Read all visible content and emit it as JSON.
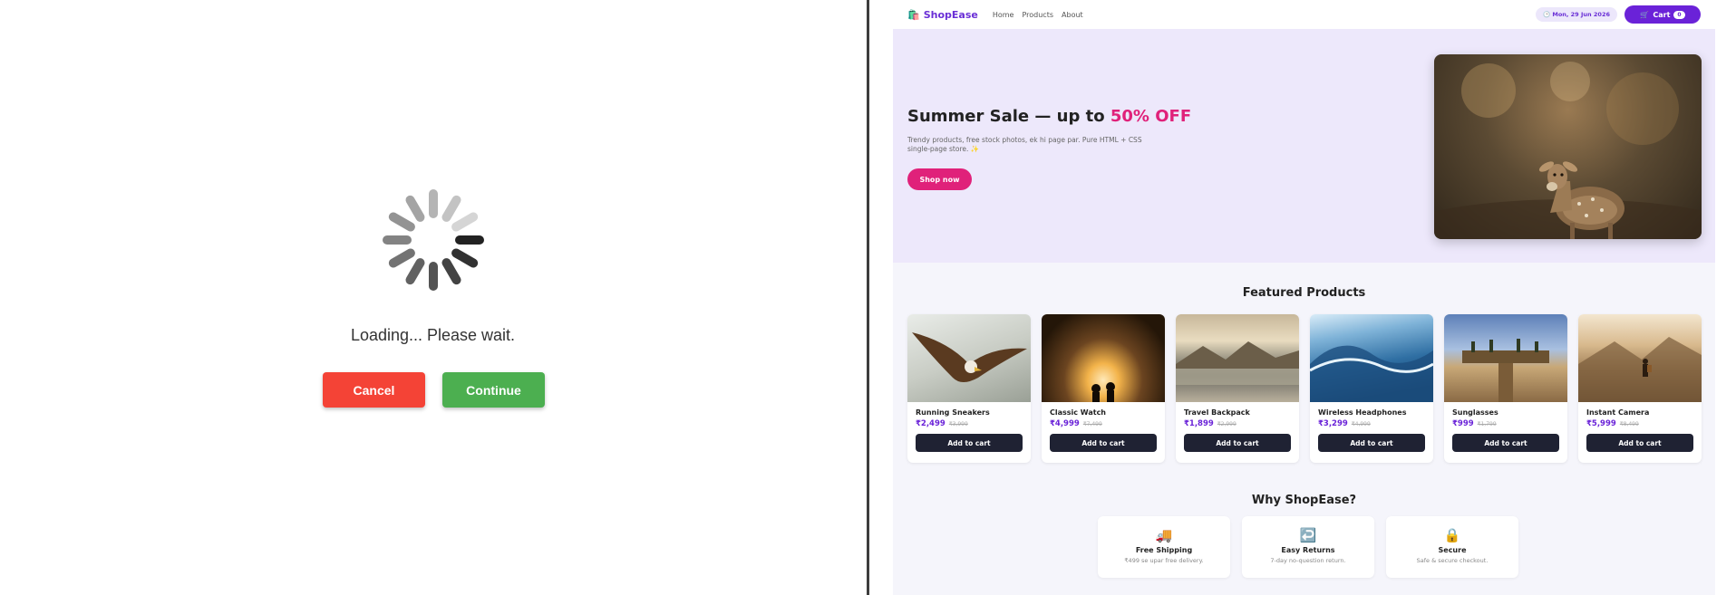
{
  "loading": {
    "message": "Loading... Please wait.",
    "cancel_label": "Cancel",
    "continue_label": "Continue",
    "spinner_icon": "spinner-icon"
  },
  "shop": {
    "brand": "ShopEase",
    "brand_icon": "shopping-bag-icon",
    "nav_links": [
      "Home",
      "Products",
      "About"
    ],
    "date": "Mon, 29 Jun 2026",
    "cart_label": "Cart",
    "cart_count": "0",
    "hero": {
      "title_prefix": "Summer Sale — up to ",
      "title_accent": "50% OFF",
      "subtitle": "Trendy products, free stock photos, ek hi page par. Pure HTML + CSS single-page store. ✨",
      "cta": "Shop now",
      "image_subject": "deer"
    },
    "featured_title": "Featured Products",
    "products": [
      {
        "name": "Running Sneakers",
        "price": "₹2,499",
        "old_price": "₹3,999",
        "cta": "Add to cart",
        "image_subject": "eagle"
      },
      {
        "name": "Classic Watch",
        "price": "₹4,999",
        "old_price": "₹7,499",
        "cta": "Add to cart",
        "image_subject": "cave-silhouettes"
      },
      {
        "name": "Travel Backpack",
        "price": "₹1,899",
        "old_price": "₹2,999",
        "cta": "Add to cart",
        "image_subject": "lake-landscape"
      },
      {
        "name": "Wireless Headphones",
        "price": "₹3,299",
        "old_price": "₹4,999",
        "cta": "Add to cart",
        "image_subject": "ocean-wave"
      },
      {
        "name": "Sunglasses",
        "price": "₹999",
        "old_price": "₹1,799",
        "cta": "Add to cart",
        "image_subject": "pier"
      },
      {
        "name": "Instant Camera",
        "price": "₹5,999",
        "old_price": "₹8,499",
        "cta": "Add to cart",
        "image_subject": "hiker-mountains"
      }
    ],
    "why_title": "Why ShopEase?",
    "features": [
      {
        "icon": "🚚",
        "icon_name": "truck-icon",
        "title": "Free Shipping",
        "desc": "₹499 se upar free delivery."
      },
      {
        "icon": "↩️",
        "icon_name": "return-icon",
        "title": "Easy Returns",
        "desc": "7-day no-question return."
      },
      {
        "icon": "🔒",
        "icon_name": "lock-icon",
        "title": "Secure",
        "desc": "Safe & secure checkout."
      }
    ]
  },
  "colors": {
    "cancel": "#f44336",
    "continue": "#4caf50",
    "brand": "#6a22d8",
    "accent": "#e0217a",
    "button_dark": "#1f2233"
  }
}
